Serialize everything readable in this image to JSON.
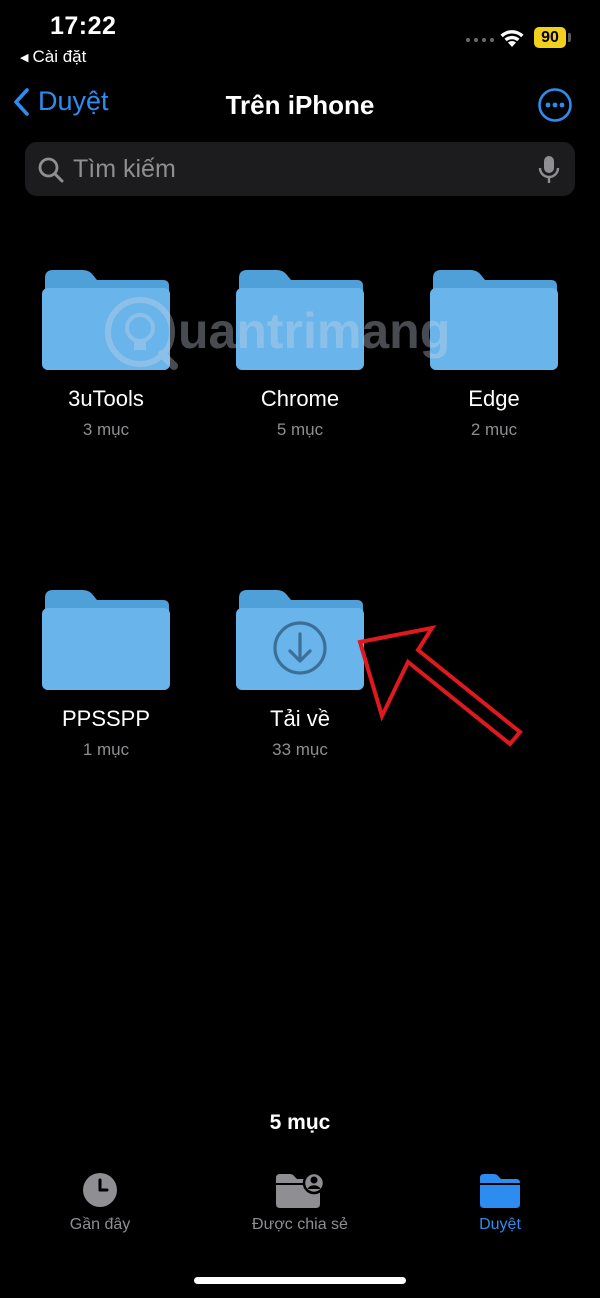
{
  "status_bar": {
    "time": "17:22",
    "back_app": "Cài đặt",
    "battery": "90"
  },
  "nav": {
    "back_label": "Duyệt",
    "title": "Trên iPhone"
  },
  "search": {
    "placeholder": "Tìm kiếm"
  },
  "folders": [
    {
      "name": "3uTools",
      "count": "3 mục"
    },
    {
      "name": "Chrome",
      "count": "5 mục"
    },
    {
      "name": "Edge",
      "count": "2 mục"
    },
    {
      "name": "PPSSPP",
      "count": "1 mục"
    },
    {
      "name": "Tải về",
      "count": "33 mục",
      "icon": "download-icon"
    }
  ],
  "footer": {
    "item_count": "5 mục"
  },
  "tab_bar": {
    "tabs": [
      {
        "label": "Gần đây",
        "icon": "clock-icon",
        "active": false
      },
      {
        "label": "Được chia sẻ",
        "icon": "shared-folder-icon",
        "active": false
      },
      {
        "label": "Duyệt",
        "icon": "folder-icon",
        "active": true
      }
    ]
  },
  "watermark": "uantrimang",
  "colors": {
    "accent": "#2d8cf0",
    "folder": "#69b4ea",
    "battery": "#f2d11e",
    "annotation_arrow": "#e0191f"
  }
}
